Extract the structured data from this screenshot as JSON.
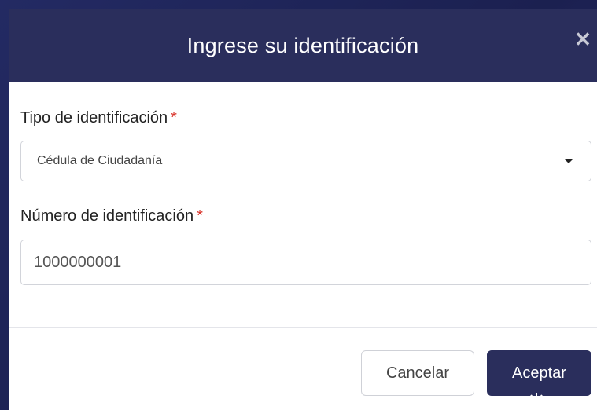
{
  "modal": {
    "title": "Ingrese su identificación",
    "close_icon": "close-icon"
  },
  "id_type": {
    "label": "Tipo de identificación",
    "required_mark": "*",
    "selected_value": "Cédula de Ciudadanía",
    "caret_icon": "chevron-down-icon"
  },
  "id_number": {
    "label": "Número de identificación",
    "required_mark": "*",
    "value": "1000000001"
  },
  "actions": {
    "cancel_label": "Cancelar",
    "accept_label": "Aceptar"
  },
  "colors": {
    "header_bg": "#2a2e5c",
    "primary_button": "#2a2e5c",
    "required": "#d9342b"
  }
}
